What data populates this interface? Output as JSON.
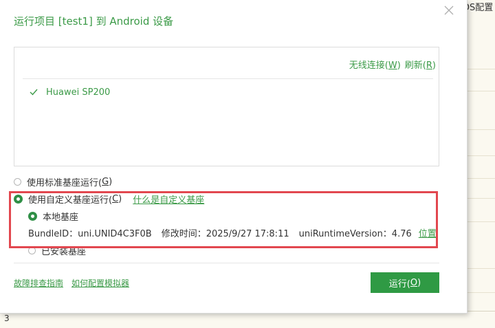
{
  "dialog": {
    "title": "运行项目 [test1] 到 Android 设备"
  },
  "device_panel": {
    "wireless_label": "无线连接(",
    "wireless_key": "W",
    "wireless_end": ")",
    "refresh_label": "刷新(",
    "refresh_key": "R",
    "refresh_end": ")",
    "devices": [
      {
        "name": "Huawei SP200",
        "checked": true
      }
    ]
  },
  "options": {
    "standard": {
      "label": "使用标准基座运行(",
      "key": "G",
      "end": ")",
      "selected": false
    },
    "custom": {
      "label": "使用自定义基座运行(",
      "key": "C",
      "end": ")",
      "selected": true,
      "help_link": "什么是自定义基座"
    },
    "local": {
      "label": "本地基座",
      "selected": true
    },
    "installed": {
      "label": "已安装基座",
      "selected": false
    }
  },
  "base_info": {
    "bundle_id": "BundleID：uni.UNID4C3F0B",
    "modified": "修改时间：2025/9/27 17:8:11",
    "runtime_version": "uniRuntimeVersion：4.76",
    "location_link": "位置"
  },
  "footer": {
    "troubleshoot_link": "故障排查指南",
    "emulator_link": "如何配置模拟器",
    "run_label": "运行(",
    "run_key": "O",
    "run_end": ")"
  },
  "background": {
    "side_link": "DS配置",
    "line_number": "3"
  },
  "colors": {
    "accent_green": "#3b9a47",
    "button_green": "#2f9a44",
    "highlight_red": "#e2474f"
  }
}
